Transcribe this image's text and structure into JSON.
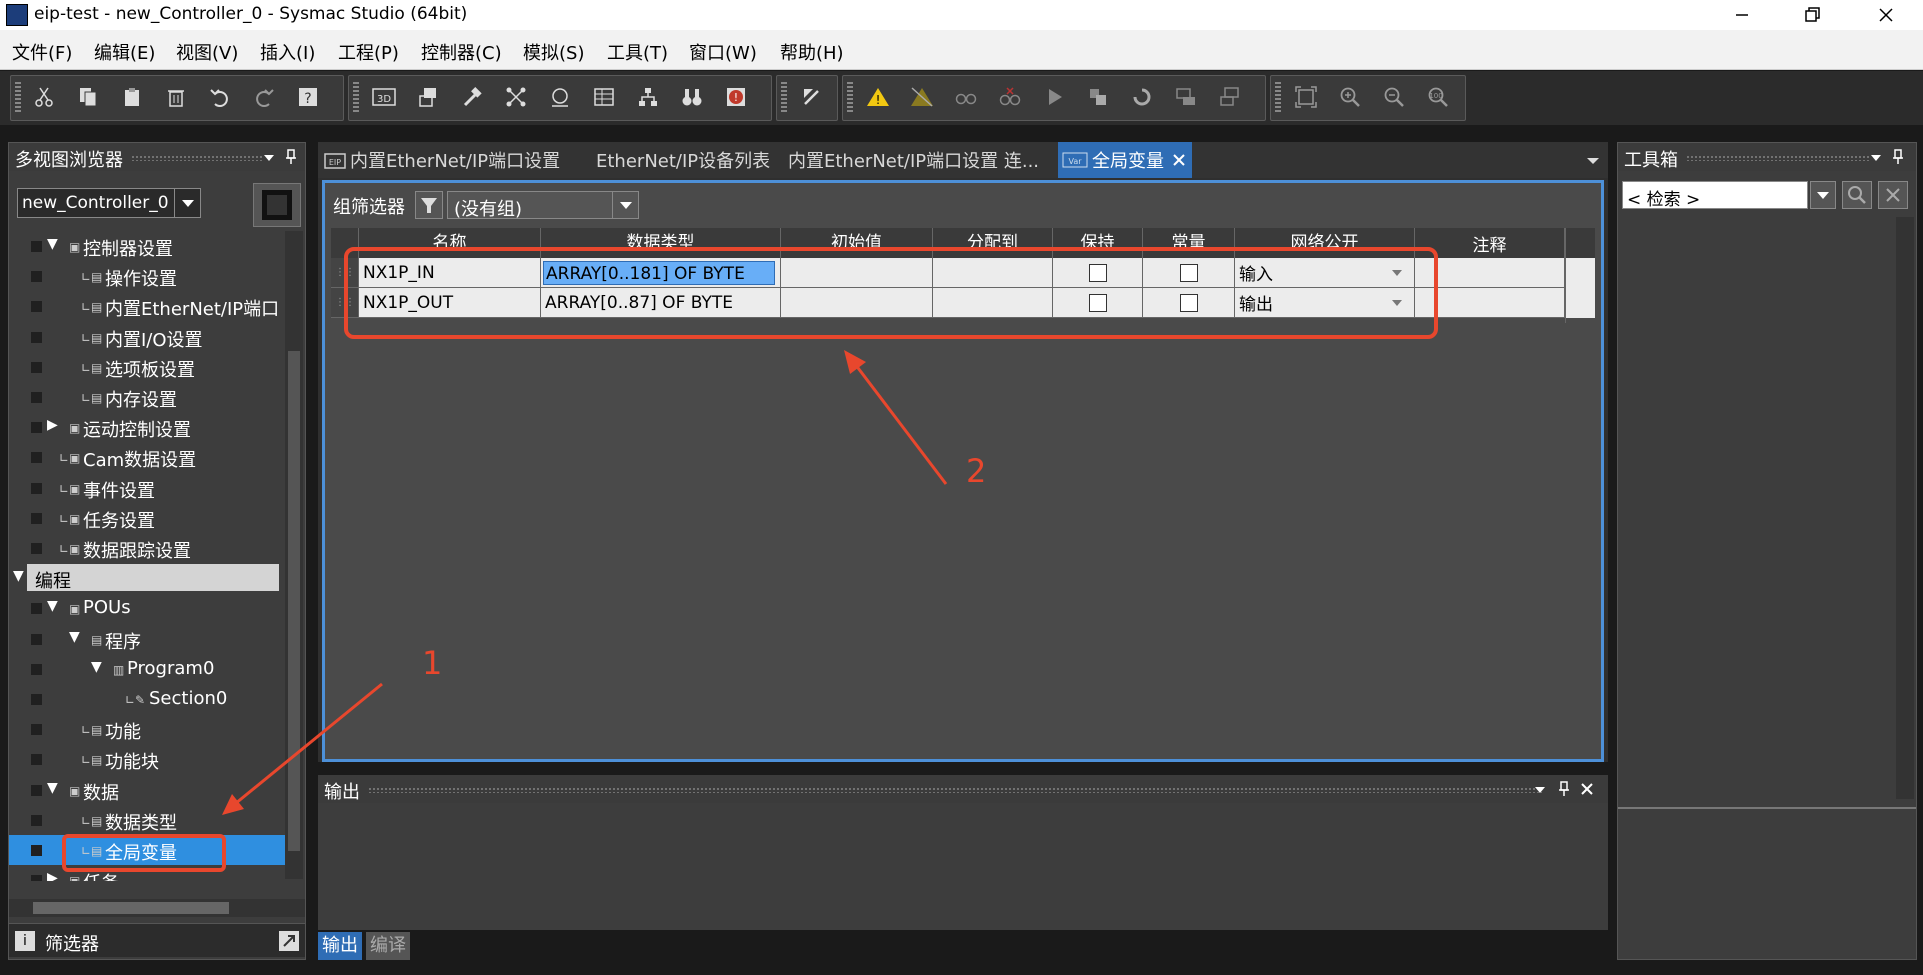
{
  "window": {
    "title": "eip-test - new_Controller_0 - Sysmac Studio (64bit)",
    "buttons": [
      "minimize",
      "maximize",
      "close"
    ]
  },
  "menu": [
    "文件(F)",
    "编辑(E)",
    "视图(V)",
    "插入(I)",
    "工程(P)",
    "控制器(C)",
    "模拟(S)",
    "工具(T)",
    "窗口(W)",
    "帮助(H)"
  ],
  "toolbar": {
    "groups": [
      [
        "cut-icon",
        "copy-icon",
        "paste-icon",
        "delete-icon",
        "undo-icon",
        "redo-icon",
        "help-icon"
      ],
      [
        "3d-icon",
        "layers-icon",
        "build-icon",
        "network-icon",
        "monitor-icon",
        "table-icon",
        "tree-icon",
        "binoculars-icon",
        "alert-icon"
      ],
      [
        "transfer-icon"
      ],
      [
        "online-warning-icon",
        "offline-icon",
        "glasses-icon",
        "glasses-x-icon",
        "play-icon",
        "stop-icon",
        "refresh-icon",
        "sync-icon",
        "compare-icon"
      ],
      [
        "fit-icon",
        "zoom-in-icon",
        "zoom-out-icon",
        "zoom-reset-icon"
      ]
    ]
  },
  "left_panel": {
    "title": "多视图浏览器",
    "controller": "new_Controller_0",
    "section_programming": "编程",
    "tree": [
      {
        "label": "控制器设置",
        "indent": 1,
        "expander": "▼"
      },
      {
        "label": "操作设置",
        "indent": 2,
        "expander": ""
      },
      {
        "label": "内置EtherNet/IP端口",
        "indent": 2,
        "expander": ""
      },
      {
        "label": "内置I/O设置",
        "indent": 2,
        "expander": ""
      },
      {
        "label": "选项板设置",
        "indent": 2,
        "expander": ""
      },
      {
        "label": "内存设置",
        "indent": 2,
        "expander": ""
      },
      {
        "label": "运动控制设置",
        "indent": 1,
        "expander": "▶"
      },
      {
        "label": "Cam数据设置",
        "indent": 1,
        "expander": ""
      },
      {
        "label": "事件设置",
        "indent": 1,
        "expander": ""
      },
      {
        "label": "任务设置",
        "indent": 1,
        "expander": ""
      },
      {
        "label": "数据跟踪设置",
        "indent": 1,
        "expander": ""
      },
      {
        "label": "POUs",
        "indent": 1,
        "expander": "▼"
      },
      {
        "label": "程序",
        "indent": 2,
        "expander": "▼"
      },
      {
        "label": "Program0",
        "indent": 3,
        "expander": "▼"
      },
      {
        "label": "Section0",
        "indent": 4,
        "expander": ""
      },
      {
        "label": "功能",
        "indent": 2,
        "expander": ""
      },
      {
        "label": "功能块",
        "indent": 2,
        "expander": ""
      },
      {
        "label": "数据",
        "indent": 1,
        "expander": "▼"
      },
      {
        "label": "数据类型",
        "indent": 2,
        "expander": ""
      },
      {
        "label": "全局变量",
        "indent": 2,
        "expander": "",
        "selected": true
      },
      {
        "label": "任务",
        "indent": 1,
        "expander": "▶"
      }
    ],
    "filter_label": "筛选器"
  },
  "tabs": [
    {
      "label": "内置EtherNet/IP端口设置",
      "active": false
    },
    {
      "label": "EtherNet/IP设备列表",
      "active": false
    },
    {
      "label": "内置EtherNet/IP端口设置 连...",
      "active": false
    },
    {
      "label": "全局变量",
      "active": true
    }
  ],
  "editor": {
    "group_filter_label": "组筛选器",
    "group_filter_value": "(没有组)",
    "columns": [
      "名称",
      "数据类型",
      "初始值",
      "分配到",
      "保持",
      "常量",
      "网络公开",
      "注释"
    ],
    "rows": [
      {
        "name": "NX1P_IN",
        "type": "ARRAY[0..181] OF BYTE",
        "initial": "",
        "assign": "",
        "retain": false,
        "constant": false,
        "network": "输入",
        "comment": ""
      },
      {
        "name": "NX1P_OUT",
        "type": "ARRAY[0..87] OF BYTE",
        "initial": "",
        "assign": "",
        "retain": false,
        "constant": false,
        "network": "输出",
        "comment": ""
      }
    ]
  },
  "output_panel": {
    "title": "输出",
    "tabs": [
      "输出",
      "编译"
    ]
  },
  "right_panel": {
    "title": "工具箱",
    "search_placeholder": "< 检索 >"
  },
  "annotations": {
    "label1": "1",
    "label2": "2",
    "color": "#e8472d"
  },
  "colors": {
    "accent": "#2f6db5",
    "selection": "#4d90d8",
    "panel": "#3d3d3d"
  }
}
